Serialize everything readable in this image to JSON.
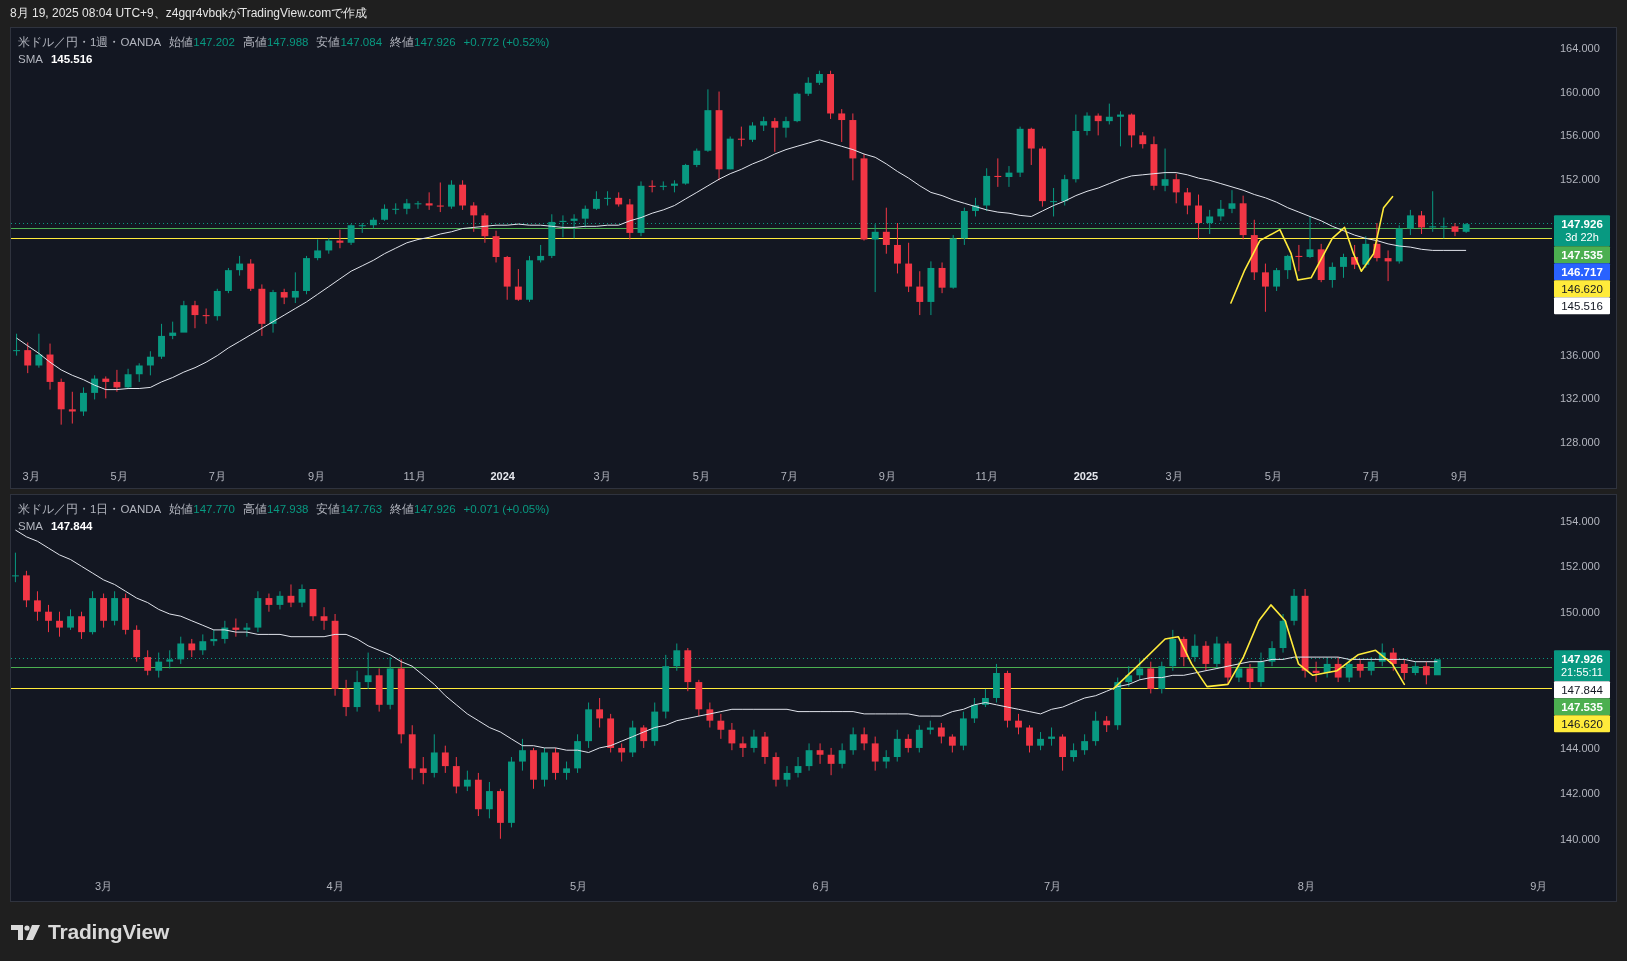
{
  "caption": "8月 19, 2025 08:04 UTC+9、z4gqr4vbqkがTradingView.comで作成",
  "panels": [
    {
      "legend": {
        "symbol": "米ドル／円・1週・OANDA",
        "fields": [
          {
            "label": "始値",
            "value": "147.202"
          },
          {
            "label": "高値",
            "value": "147.988"
          },
          {
            "label": "安値",
            "value": "147.084"
          },
          {
            "label": "終値",
            "value": "147.926"
          }
        ],
        "change": "+0.772 (+0.52%)",
        "indicator": {
          "name": "SMA",
          "value": "145.516"
        }
      },
      "price_axis_labels": [
        "164.000",
        "160.000",
        "156.000",
        "152.000",
        "136.000",
        "132.000",
        "128.000"
      ],
      "date_labels": [
        {
          "text": "3月",
          "kind": "month"
        },
        {
          "text": "5月",
          "kind": "month"
        },
        {
          "text": "7月",
          "kind": "month"
        },
        {
          "text": "9月",
          "kind": "month"
        },
        {
          "text": "11月",
          "kind": "month"
        },
        {
          "text": "2024",
          "kind": "year"
        },
        {
          "text": "3月",
          "kind": "month"
        },
        {
          "text": "5月",
          "kind": "month"
        },
        {
          "text": "7月",
          "kind": "month"
        },
        {
          "text": "9月",
          "kind": "month"
        },
        {
          "text": "11月",
          "kind": "month"
        },
        {
          "text": "2025",
          "kind": "year"
        },
        {
          "text": "3月",
          "kind": "month"
        },
        {
          "text": "5月",
          "kind": "month"
        },
        {
          "text": "7月",
          "kind": "month"
        },
        {
          "text": "9月",
          "kind": "month"
        }
      ],
      "price_lines": [
        {
          "color": "#089981",
          "dotted": true
        },
        {
          "color": "#4caf50",
          "dotted": false
        },
        {
          "color": "#ffeb3b",
          "dotted": false
        }
      ],
      "price_tags": [
        {
          "text": "147.926",
          "sublabel": "3d 22h",
          "color": "#089981"
        },
        {
          "text": "147.535",
          "color": "#4caf50"
        },
        {
          "text": "146.717",
          "color": "#2962ff"
        },
        {
          "text": "146.620",
          "color": "#ffeb3b"
        },
        {
          "text": "145.516",
          "color": "#ffffff"
        }
      ]
    },
    {
      "legend": {
        "symbol": "米ドル／円・1日・OANDA",
        "fields": [
          {
            "label": "始値",
            "value": "147.770"
          },
          {
            "label": "高値",
            "value": "147.938"
          },
          {
            "label": "安値",
            "value": "147.763"
          },
          {
            "label": "終値",
            "value": "147.926"
          }
        ],
        "change": "+0.071 (+0.05%)",
        "indicator": {
          "name": "SMA",
          "value": "147.844"
        }
      },
      "price_axis_labels": [
        "154.000",
        "152.000",
        "150.000",
        "144.000",
        "142.000",
        "140.000"
      ],
      "date_labels": [
        {
          "text": "3月",
          "kind": "month"
        },
        {
          "text": "4月",
          "kind": "month"
        },
        {
          "text": "5月",
          "kind": "month"
        },
        {
          "text": "6月",
          "kind": "month"
        },
        {
          "text": "7月",
          "kind": "month"
        },
        {
          "text": "8月",
          "kind": "month"
        },
        {
          "text": "9月",
          "kind": "month"
        }
      ],
      "price_lines": [
        {
          "color": "#089981",
          "dotted": true
        },
        {
          "color": "#4caf50",
          "dotted": false
        },
        {
          "color": "#ffeb3b",
          "dotted": false
        }
      ],
      "price_tags": [
        {
          "text": "147.926",
          "sublabel": "21:55:11",
          "color": "#089981"
        },
        {
          "text": "147.844",
          "color": "#ffffff"
        },
        {
          "text": "147.535",
          "color": "#4caf50"
        },
        {
          "text": "146.620",
          "color": "#ffeb3b"
        }
      ]
    }
  ],
  "brand": "TradingView"
}
